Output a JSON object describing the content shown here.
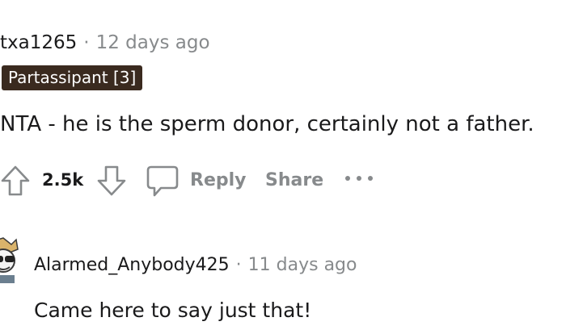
{
  "comment": {
    "username": "txa1265",
    "separator": "·",
    "timestamp": "12 days ago",
    "flair": "Partassipant [3]",
    "body": "NTA - he is the sperm donor, certainly not a father.",
    "score": "2.5k"
  },
  "actions": {
    "upvote_icon": "arrow-up-icon",
    "downvote_icon": "arrow-down-icon",
    "reply_icon": "speech-bubble-icon",
    "reply_label": "Reply",
    "share_label": "Share",
    "more_icon": "ellipsis-icon"
  },
  "reply": {
    "avatar_icon": "user-avatar",
    "username": "Alarmed_Anybody425",
    "separator": "·",
    "timestamp": "11 days ago",
    "body": "Came here to say just that!"
  },
  "colors": {
    "text": "#1a1a1b",
    "muted": "#878a8c",
    "flair_bg": "#3a2a1f",
    "flair_text": "#ffffff"
  }
}
